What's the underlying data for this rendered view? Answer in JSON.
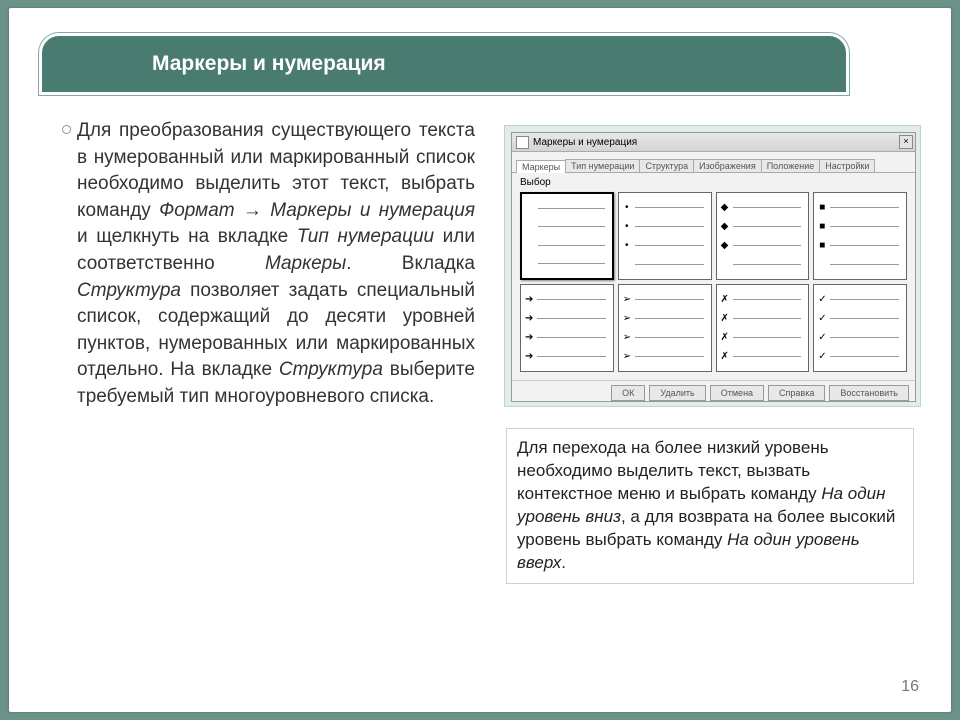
{
  "title": "Маркеры и нумерация",
  "body_parts": {
    "p1": "Для преобразования существующего текста в нумерованный или маркированный список необходимо выделить этот текст, выбрать команду ",
    "p2": "Формат → Маркеры и нумерация",
    "p3": " и щелкнуть на вкладке ",
    "p4": "Тип нумерации",
    "p5": " или соответственно ",
    "p6": "Маркеры",
    "p7": ". Вкладка ",
    "p8": "Структура",
    "p9": " позволяет задать специальный список, содержащий до десяти уровней пунктов, нумерованных или маркированных отдельно. На вкладке ",
    "p10": "Структура",
    "p11": " выберите требуемый тип многоуровневого списка."
  },
  "dialog": {
    "title": "Маркеры и нумерация",
    "close": "×",
    "tabs": [
      "Маркеры",
      "Тип нумерации",
      "Структура",
      "Изображения",
      "Положение",
      "Настройки"
    ],
    "section": "Выбор",
    "markers": [
      "",
      "•",
      "◆",
      "■",
      "➔",
      "➢",
      "✗",
      "✓"
    ],
    "buttons": [
      "ОК",
      "Удалить",
      "Отмена",
      "Справка",
      "Восстановить"
    ]
  },
  "note_parts": {
    "n1": "Для перехода на более низкий уровень необходимо выделить текст, вызвать контекстное меню и выбрать команду ",
    "n2": "На один уровень вниз",
    "n3": ", а для возврата на более высокий уровень выбрать команду ",
    "n4": "На один уровень вверх",
    "n5": "."
  },
  "page_number": "16"
}
